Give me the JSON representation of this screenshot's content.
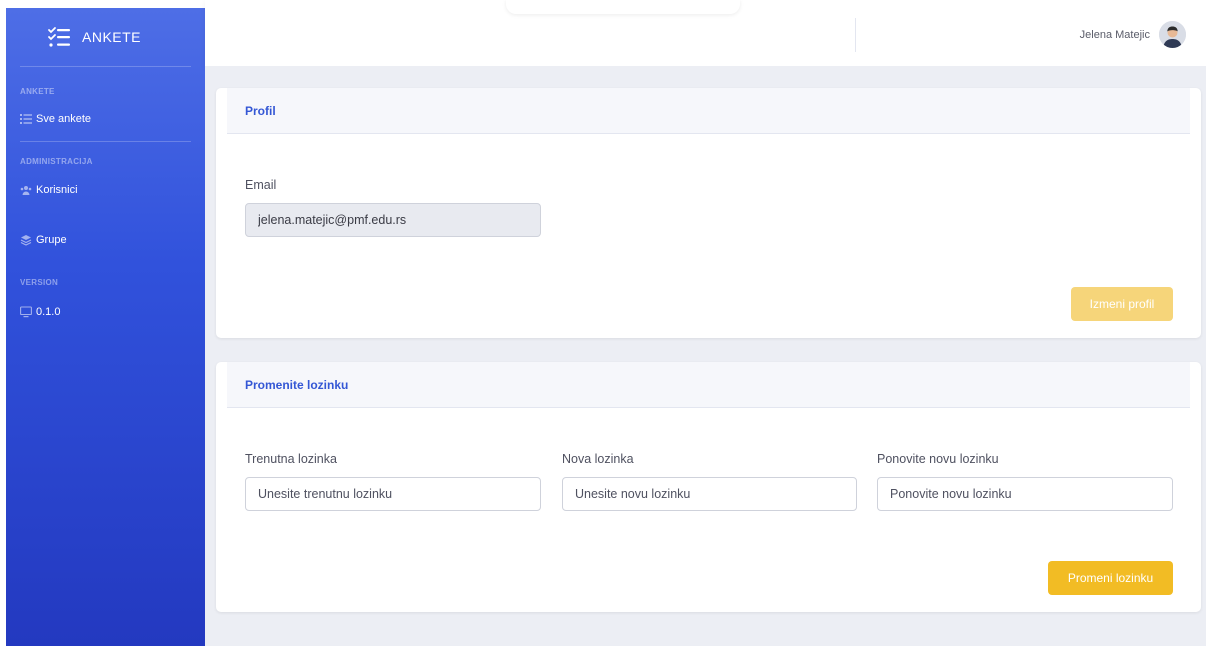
{
  "app": {
    "brand": "ANKETE"
  },
  "sidebar": {
    "sections": [
      {
        "label": "ANKETE",
        "items": [
          {
            "label": "Sve ankete",
            "icon": "list-icon"
          }
        ]
      },
      {
        "label": "ADMINISTRACIJA",
        "items": [
          {
            "label": "Korisnici",
            "icon": "users-icon"
          },
          {
            "label": "Grupe",
            "icon": "layers-icon"
          }
        ]
      },
      {
        "label": "VERSION",
        "items": [
          {
            "label": "0.1.0",
            "icon": "monitor-icon"
          }
        ]
      }
    ]
  },
  "topbar": {
    "user_name": "Jelena Matejic"
  },
  "profile": {
    "title": "Profil",
    "email_label": "Email",
    "email_value": "jelena.matejic@pmf.edu.rs",
    "submit_label": "Izmeni profil"
  },
  "password": {
    "title": "Promenite lozinku",
    "current_label": "Trenutna lozinka",
    "current_placeholder": "Unesite trenutnu lozinku",
    "new_label": "Nova lozinka",
    "new_placeholder": "Unesite novu lozinku",
    "repeat_label": "Ponovite novu lozinku",
    "repeat_placeholder": "Ponovite novu lozinku",
    "submit_label": "Promeni lozinku"
  },
  "colors": {
    "sidebar_top": "#4e6ee6",
    "sidebar_bottom": "#2339c0",
    "accent": "#3457d5",
    "button": "#f2bc24",
    "button_disabled": "#f6d57a"
  }
}
